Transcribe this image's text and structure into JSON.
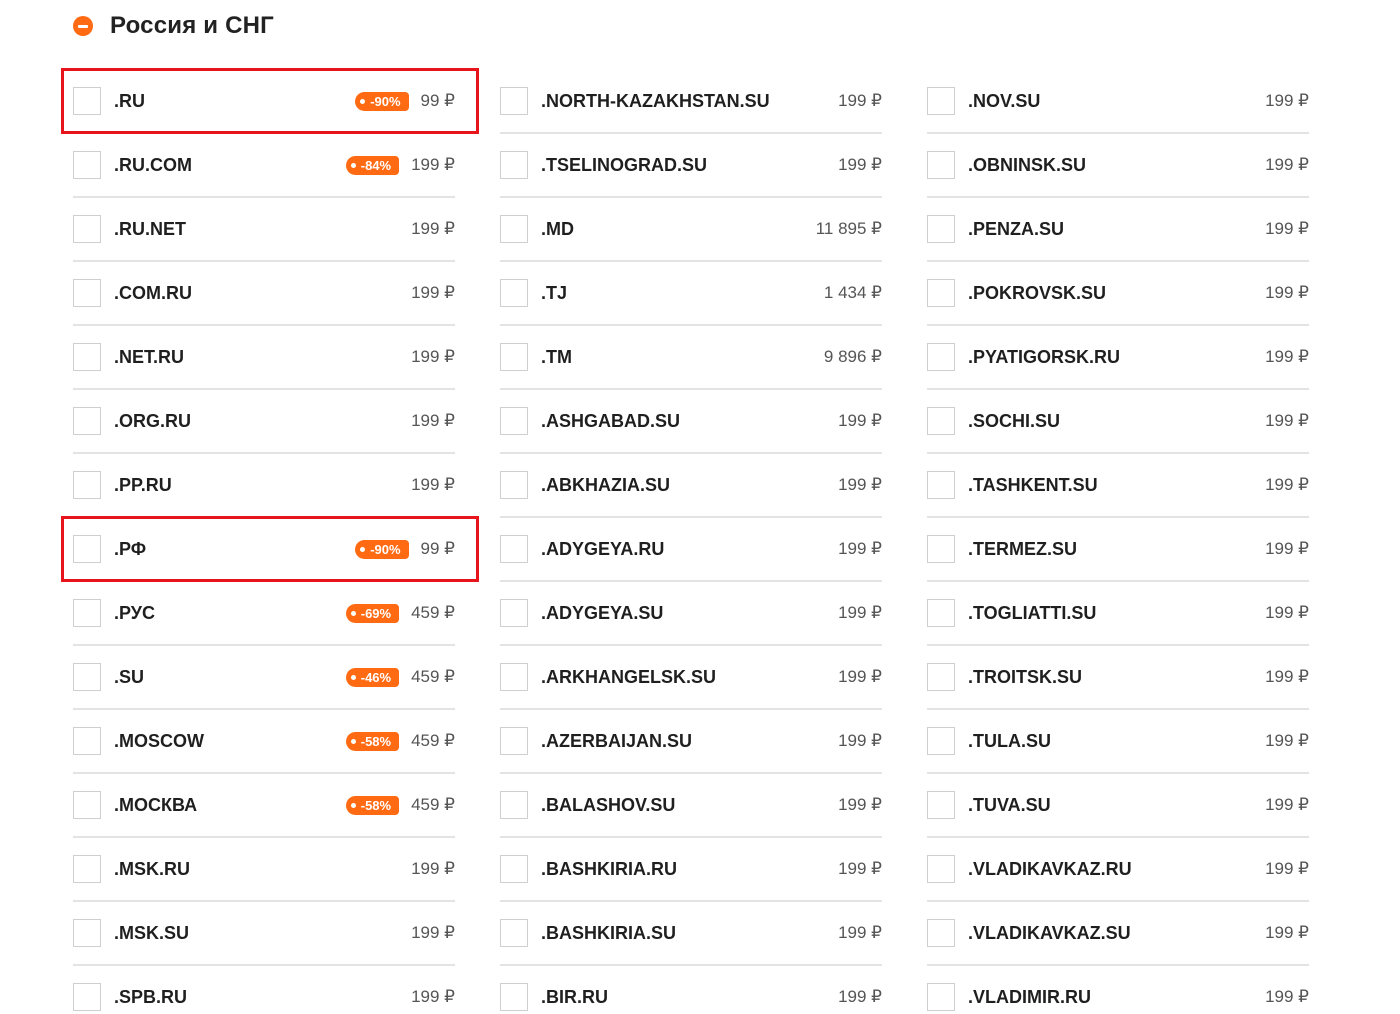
{
  "section": {
    "title": "Россия и СНГ",
    "icon": "collapse-minus-icon",
    "accent_color": "#ff6a13",
    "highlight_color": "#e8141c"
  },
  "columns": [
    {
      "rows": [
        {
          "name": ".RU",
          "discount": "-90%",
          "price": "99 ₽",
          "highlighted": true
        },
        {
          "name": ".RU.COM",
          "discount": "-84%",
          "price": "199 ₽"
        },
        {
          "name": ".RU.NET",
          "discount": null,
          "price": "199 ₽"
        },
        {
          "name": ".COM.RU",
          "discount": null,
          "price": "199 ₽"
        },
        {
          "name": ".NET.RU",
          "discount": null,
          "price": "199 ₽"
        },
        {
          "name": ".ORG.RU",
          "discount": null,
          "price": "199 ₽"
        },
        {
          "name": ".PP.RU",
          "discount": null,
          "price": "199 ₽"
        },
        {
          "name": ".РФ",
          "discount": "-90%",
          "price": "99 ₽",
          "highlighted": true
        },
        {
          "name": ".РУС",
          "discount": "-69%",
          "price": "459 ₽"
        },
        {
          "name": ".SU",
          "discount": "-46%",
          "price": "459 ₽"
        },
        {
          "name": ".MOSCOW",
          "discount": "-58%",
          "price": "459 ₽"
        },
        {
          "name": ".МОСКВА",
          "discount": "-58%",
          "price": "459 ₽"
        },
        {
          "name": ".MSK.RU",
          "discount": null,
          "price": "199 ₽"
        },
        {
          "name": ".MSK.SU",
          "discount": null,
          "price": "199 ₽"
        },
        {
          "name": ".SPB.RU",
          "discount": null,
          "price": "199 ₽"
        }
      ]
    },
    {
      "rows": [
        {
          "name": ".NORTH-KAZAKHSTAN.SU",
          "discount": null,
          "price": "199 ₽"
        },
        {
          "name": ".TSELINOGRAD.SU",
          "discount": null,
          "price": "199 ₽"
        },
        {
          "name": ".MD",
          "discount": null,
          "price": "11 895 ₽"
        },
        {
          "name": ".TJ",
          "discount": null,
          "price": "1 434 ₽"
        },
        {
          "name": ".TM",
          "discount": null,
          "price": "9 896 ₽"
        },
        {
          "name": ".ASHGABAD.SU",
          "discount": null,
          "price": "199 ₽"
        },
        {
          "name": ".ABKHAZIA.SU",
          "discount": null,
          "price": "199 ₽"
        },
        {
          "name": ".ADYGEYA.RU",
          "discount": null,
          "price": "199 ₽"
        },
        {
          "name": ".ADYGEYA.SU",
          "discount": null,
          "price": "199 ₽"
        },
        {
          "name": ".ARKHANGELSK.SU",
          "discount": null,
          "price": "199 ₽"
        },
        {
          "name": ".AZERBAIJAN.SU",
          "discount": null,
          "price": "199 ₽"
        },
        {
          "name": ".BALASHOV.SU",
          "discount": null,
          "price": "199 ₽"
        },
        {
          "name": ".BASHKIRIA.RU",
          "discount": null,
          "price": "199 ₽"
        },
        {
          "name": ".BASHKIRIA.SU",
          "discount": null,
          "price": "199 ₽"
        },
        {
          "name": ".BIR.RU",
          "discount": null,
          "price": "199 ₽"
        }
      ]
    },
    {
      "rows": [
        {
          "name": ".NOV.SU",
          "discount": null,
          "price": "199 ₽"
        },
        {
          "name": ".OBNINSK.SU",
          "discount": null,
          "price": "199 ₽"
        },
        {
          "name": ".PENZA.SU",
          "discount": null,
          "price": "199 ₽"
        },
        {
          "name": ".POKROVSK.SU",
          "discount": null,
          "price": "199 ₽"
        },
        {
          "name": ".PYATIGORSK.RU",
          "discount": null,
          "price": "199 ₽"
        },
        {
          "name": ".SOCHI.SU",
          "discount": null,
          "price": "199 ₽"
        },
        {
          "name": ".TASHKENT.SU",
          "discount": null,
          "price": "199 ₽"
        },
        {
          "name": ".TERMEZ.SU",
          "discount": null,
          "price": "199 ₽"
        },
        {
          "name": ".TOGLIATTI.SU",
          "discount": null,
          "price": "199 ₽"
        },
        {
          "name": ".TROITSK.SU",
          "discount": null,
          "price": "199 ₽"
        },
        {
          "name": ".TULA.SU",
          "discount": null,
          "price": "199 ₽"
        },
        {
          "name": ".TUVA.SU",
          "discount": null,
          "price": "199 ₽"
        },
        {
          "name": ".VLADIKAVKAZ.RU",
          "discount": null,
          "price": "199 ₽"
        },
        {
          "name": ".VLADIKAVKAZ.SU",
          "discount": null,
          "price": "199 ₽"
        },
        {
          "name": ".VLADIMIR.RU",
          "discount": null,
          "price": "199 ₽"
        }
      ]
    }
  ]
}
